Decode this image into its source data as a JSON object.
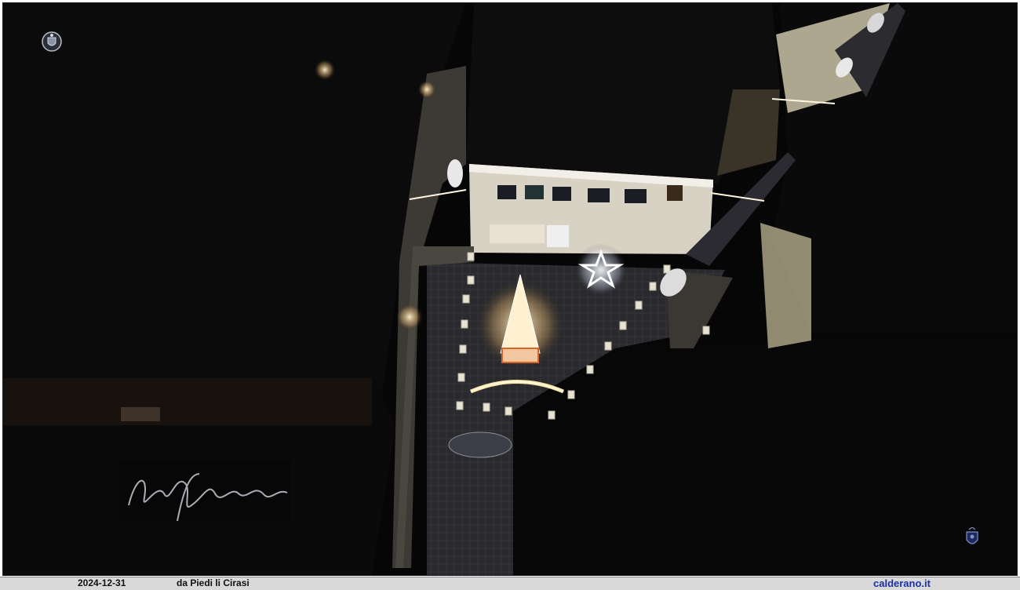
{
  "caption": {
    "date": "2024-12-31",
    "location": "da Piedi li Cirasi",
    "website": "calderano.it"
  },
  "logos": {
    "top_left": "crest-icon",
    "bottom_right": "crest-icon"
  },
  "signature": "Calderano",
  "colors": {
    "photo_background": "#050505",
    "caption_bar": "#d9d9d9",
    "website_text": "#1a2fa8",
    "light_warm": "#ffe6b0",
    "light_white": "#ffffff"
  }
}
